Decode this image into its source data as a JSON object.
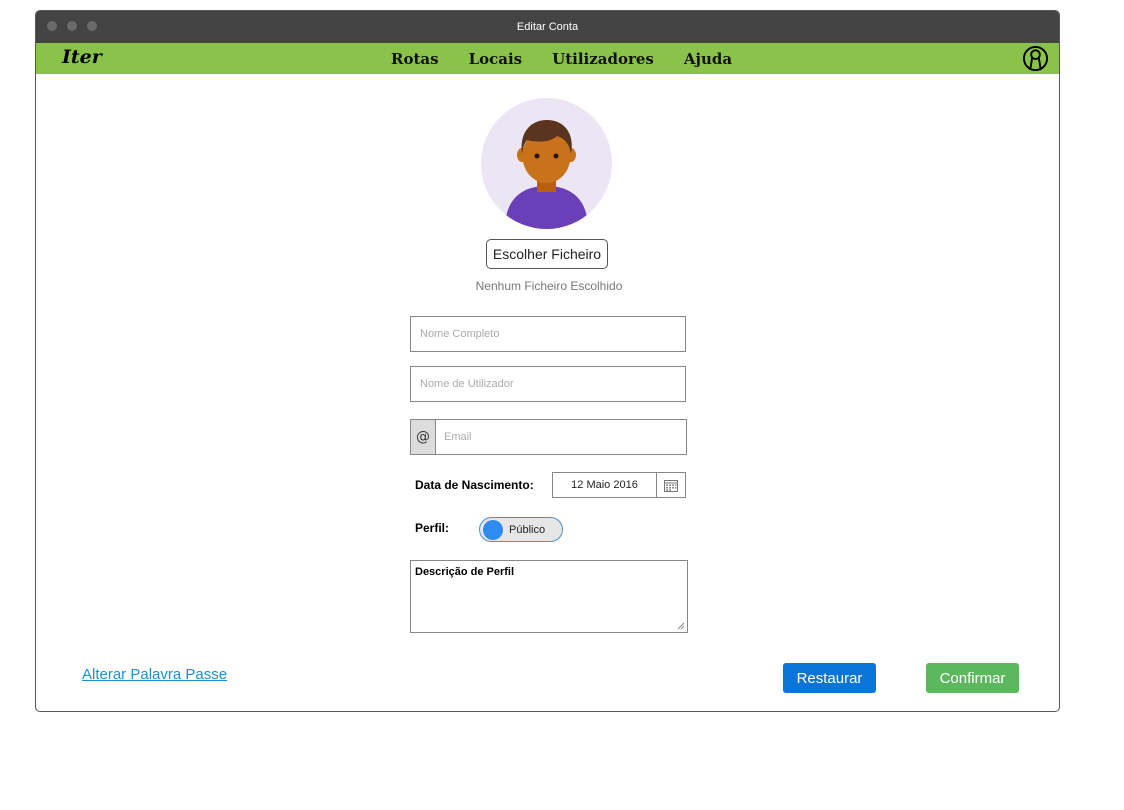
{
  "window": {
    "title": "Editar Conta"
  },
  "navbar": {
    "logo": "Iter",
    "items": [
      {
        "label": "Rotas"
      },
      {
        "label": "Locais"
      },
      {
        "label": "Utilizadores"
      },
      {
        "label": "Ajuda"
      }
    ],
    "user_icon": "user-circle-icon"
  },
  "profile": {
    "choose_file_label": "Escolher Ficheiro",
    "file_status": "Nenhum Ficheiro Escolhido"
  },
  "form": {
    "full_name": {
      "value": "",
      "placeholder": "Nome Completo"
    },
    "username": {
      "value": "",
      "placeholder": "Nome de Utilizador"
    },
    "email": {
      "prefix": "@",
      "value": "",
      "placeholder": "Email"
    },
    "birth_date": {
      "label": "Data de Nascimento:",
      "value": "12 Maio 2016"
    },
    "profile_visibility": {
      "label": "Perfil:",
      "value": "Público"
    },
    "description": {
      "label": "Descrição de Perfil"
    }
  },
  "actions": {
    "change_password": "Alterar Palavra Passe",
    "restore": "Restaurar",
    "confirm": "Confirmar"
  },
  "colors": {
    "navbar": "#8bc34a",
    "titlebar": "#444444",
    "restore": "#0a74d8",
    "confirm": "#5cb85c",
    "toggle_knob": "#2d8cf0",
    "link": "#1e8fd1"
  }
}
